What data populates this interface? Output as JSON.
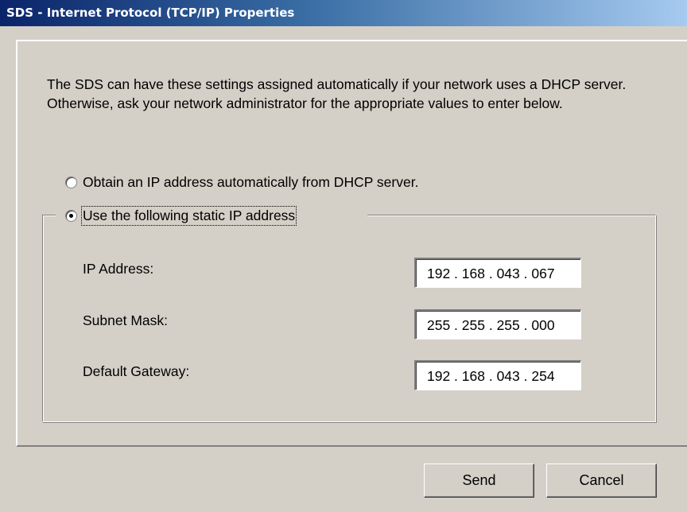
{
  "window": {
    "title": "SDS - Internet Protocol (TCP/IP) Properties"
  },
  "intro": {
    "text": "The SDS can have these settings assigned automatically if your network uses a DHCP server.  Otherwise, ask your network administrator for the appropriate values to enter below."
  },
  "options": {
    "dhcp": {
      "label": "Obtain an IP address automatically from DHCP server.",
      "selected": false
    },
    "static": {
      "label": "Use the following static IP address",
      "selected": true
    }
  },
  "fields": {
    "ip_address": {
      "label": "IP Address:",
      "value": "192 . 168 . 043 . 067"
    },
    "subnet_mask": {
      "label": "Subnet Mask:",
      "value": "255 . 255 . 255 . 000"
    },
    "default_gateway": {
      "label": "Default Gateway:",
      "value": "192 . 168 . 043 . 254"
    }
  },
  "buttons": {
    "send": "Send",
    "cancel": "Cancel"
  },
  "colors": {
    "face": "#d4d0c8",
    "title_start": "#0a246a",
    "title_end": "#a6caf0"
  }
}
